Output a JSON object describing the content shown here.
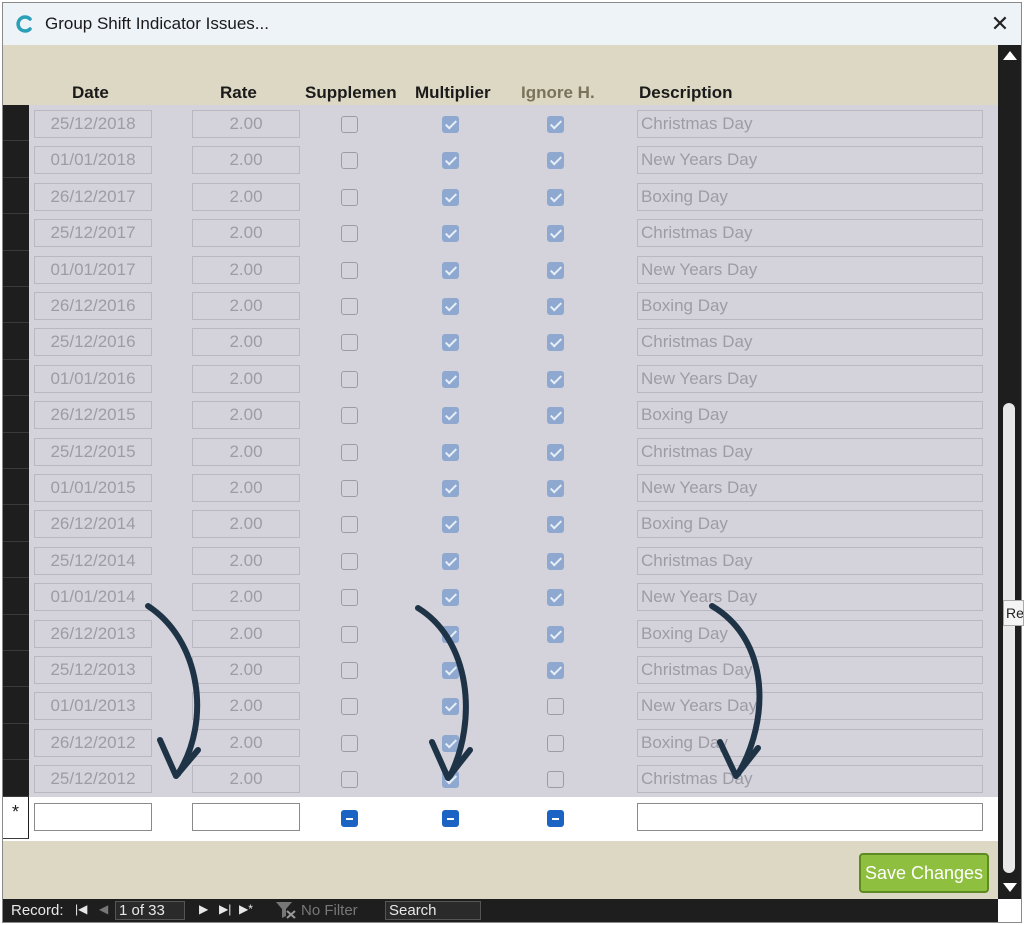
{
  "window": {
    "title": "Group Shift Indicator Issues..."
  },
  "headers": {
    "date": "Date",
    "rate": "Rate",
    "supplement": "Supplemen",
    "multiplier": "Multiplier",
    "ignore": "Ignore H.",
    "description": "Description"
  },
  "rows": [
    {
      "date": "25/12/2018",
      "rate": "2.00",
      "supplement": false,
      "multiplier": true,
      "ignore": true,
      "description": "Christmas Day"
    },
    {
      "date": "01/01/2018",
      "rate": "2.00",
      "supplement": false,
      "multiplier": true,
      "ignore": true,
      "description": "New Years Day"
    },
    {
      "date": "26/12/2017",
      "rate": "2.00",
      "supplement": false,
      "multiplier": true,
      "ignore": true,
      "description": "Boxing Day"
    },
    {
      "date": "25/12/2017",
      "rate": "2.00",
      "supplement": false,
      "multiplier": true,
      "ignore": true,
      "description": "Christmas Day"
    },
    {
      "date": "01/01/2017",
      "rate": "2.00",
      "supplement": false,
      "multiplier": true,
      "ignore": true,
      "description": "New Years Day"
    },
    {
      "date": "26/12/2016",
      "rate": "2.00",
      "supplement": false,
      "multiplier": true,
      "ignore": true,
      "description": "Boxing Day"
    },
    {
      "date": "25/12/2016",
      "rate": "2.00",
      "supplement": false,
      "multiplier": true,
      "ignore": true,
      "description": "Christmas Day"
    },
    {
      "date": "01/01/2016",
      "rate": "2.00",
      "supplement": false,
      "multiplier": true,
      "ignore": true,
      "description": "New Years Day"
    },
    {
      "date": "26/12/2015",
      "rate": "2.00",
      "supplement": false,
      "multiplier": true,
      "ignore": true,
      "description": "Boxing Day"
    },
    {
      "date": "25/12/2015",
      "rate": "2.00",
      "supplement": false,
      "multiplier": true,
      "ignore": true,
      "description": "Christmas Day"
    },
    {
      "date": "01/01/2015",
      "rate": "2.00",
      "supplement": false,
      "multiplier": true,
      "ignore": true,
      "description": "New Years Day"
    },
    {
      "date": "26/12/2014",
      "rate": "2.00",
      "supplement": false,
      "multiplier": true,
      "ignore": true,
      "description": "Boxing Day"
    },
    {
      "date": "25/12/2014",
      "rate": "2.00",
      "supplement": false,
      "multiplier": true,
      "ignore": true,
      "description": "Christmas Day"
    },
    {
      "date": "01/01/2014",
      "rate": "2.00",
      "supplement": false,
      "multiplier": true,
      "ignore": true,
      "description": "New Years Day"
    },
    {
      "date": "26/12/2013",
      "rate": "2.00",
      "supplement": false,
      "multiplier": true,
      "ignore": true,
      "description": "Boxing Day"
    },
    {
      "date": "25/12/2013",
      "rate": "2.00",
      "supplement": false,
      "multiplier": true,
      "ignore": true,
      "description": "Christmas Day"
    },
    {
      "date": "01/01/2013",
      "rate": "2.00",
      "supplement": false,
      "multiplier": true,
      "ignore": false,
      "description": "New Years Day"
    },
    {
      "date": "26/12/2012",
      "rate": "2.00",
      "supplement": false,
      "multiplier": true,
      "ignore": false,
      "description": "Boxing Day"
    },
    {
      "date": "25/12/2012",
      "rate": "2.00",
      "supplement": false,
      "multiplier": true,
      "ignore": false,
      "description": "Christmas Day"
    }
  ],
  "new_record": {
    "marker": "*",
    "date": "",
    "rate": "",
    "description": ""
  },
  "buttons": {
    "save": "Save Changes"
  },
  "navigation": {
    "record_label": "Record:",
    "position": "1 of 33",
    "filter_status": "No Filter",
    "search_placeholder": "Search"
  },
  "tooltip": {
    "text": "Re"
  },
  "colors": {
    "form_background": "#ddd8c3",
    "save_button": "#8fbf3f",
    "checkbox_indeterminate": "#1c64c4",
    "annotation_arrow": "#1f3347"
  }
}
